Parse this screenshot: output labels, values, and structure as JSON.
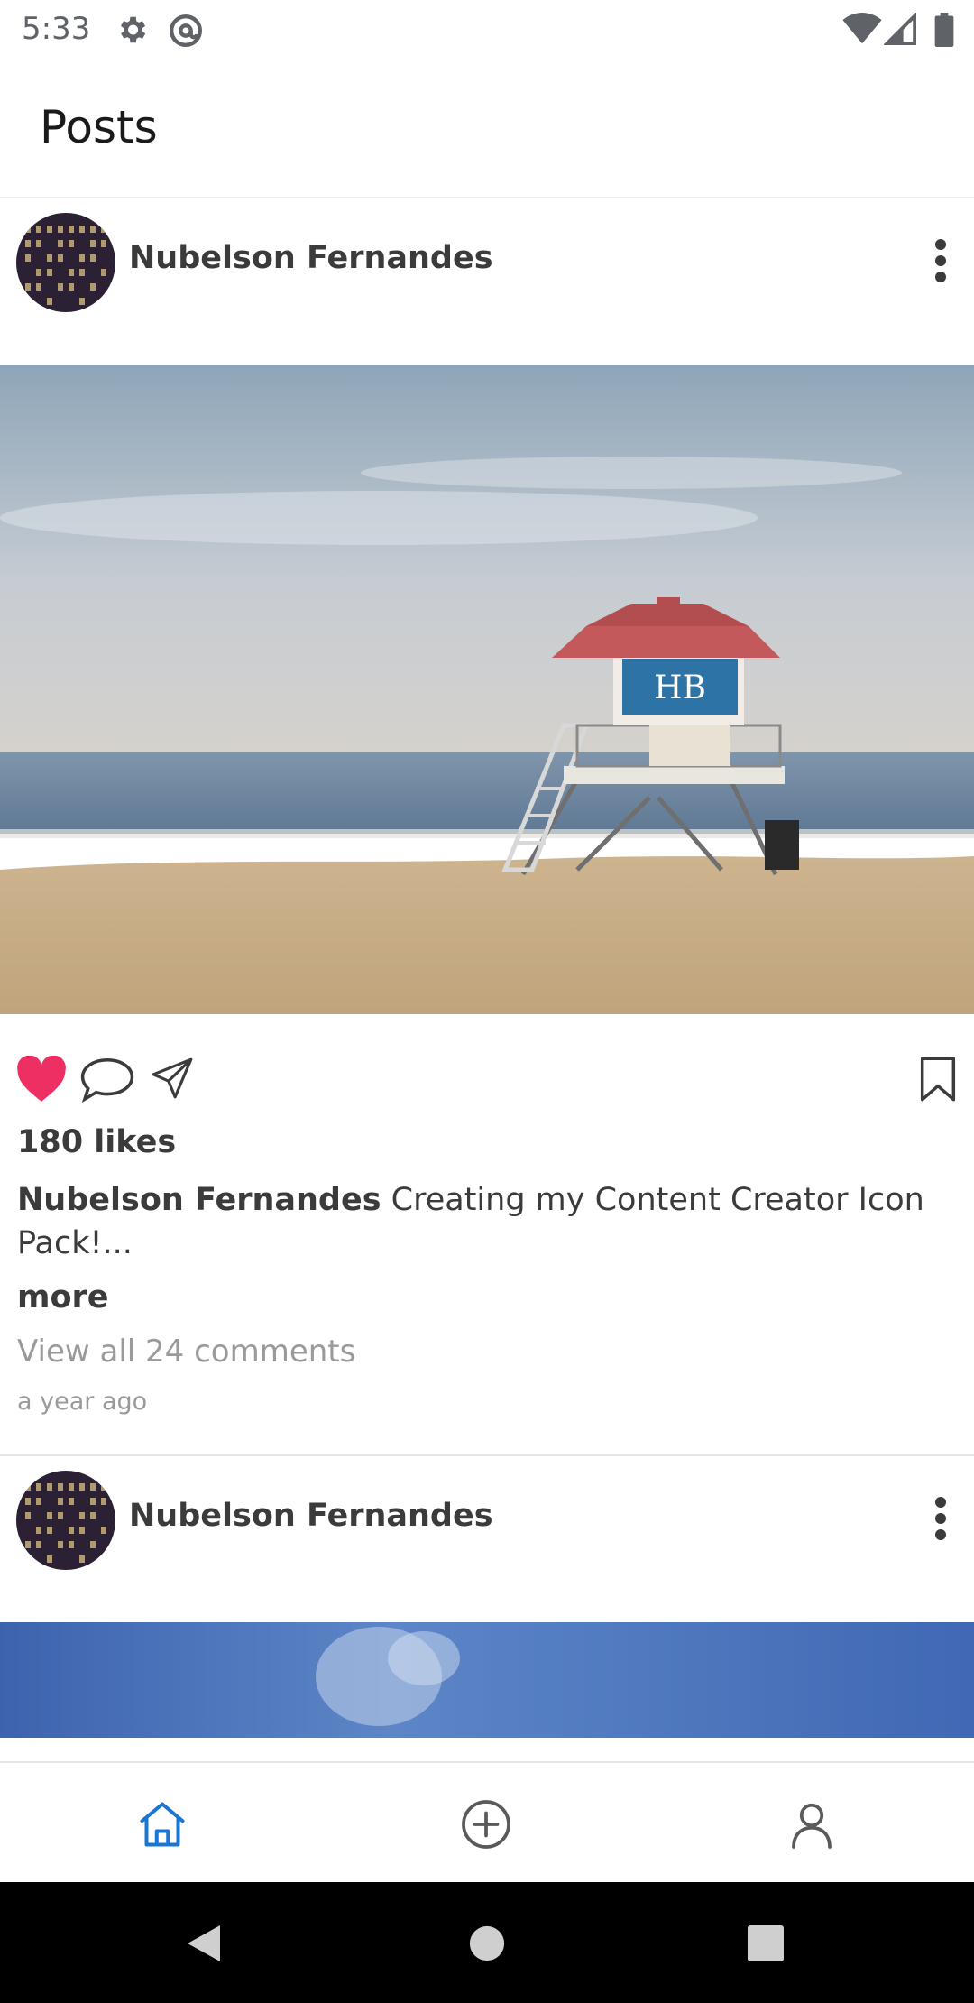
{
  "status_bar": {
    "time": "5:33",
    "icons": [
      "settings-icon",
      "at-sign-icon",
      "wifi-icon",
      "signal-icon",
      "battery-icon"
    ]
  },
  "app_bar": {
    "title": "Posts"
  },
  "posts": [
    {
      "author": "Nubelson Fernandes",
      "image": "beach-lifeguard-tower-photo",
      "liked": true,
      "likes": "180 likes",
      "caption_author": "Nubelson Fernandes",
      "caption_text": " Creating my Content Creator Icon Pack!...",
      "more_label": "more",
      "comments_label": "View all 24 comments",
      "time_ago": "a year ago"
    },
    {
      "author": "Nubelson Fernandes",
      "image": "blue-sky-photo"
    }
  ],
  "bottom_nav": {
    "items": [
      {
        "icon": "home-icon",
        "active": true
      },
      {
        "icon": "add-circle-icon",
        "active": false
      },
      {
        "icon": "profile-icon",
        "active": false
      }
    ]
  },
  "colors": {
    "accent": "#1976d2",
    "like": "#ed2f63",
    "text": "#3b3b3b",
    "muted": "#9a9a9a"
  }
}
